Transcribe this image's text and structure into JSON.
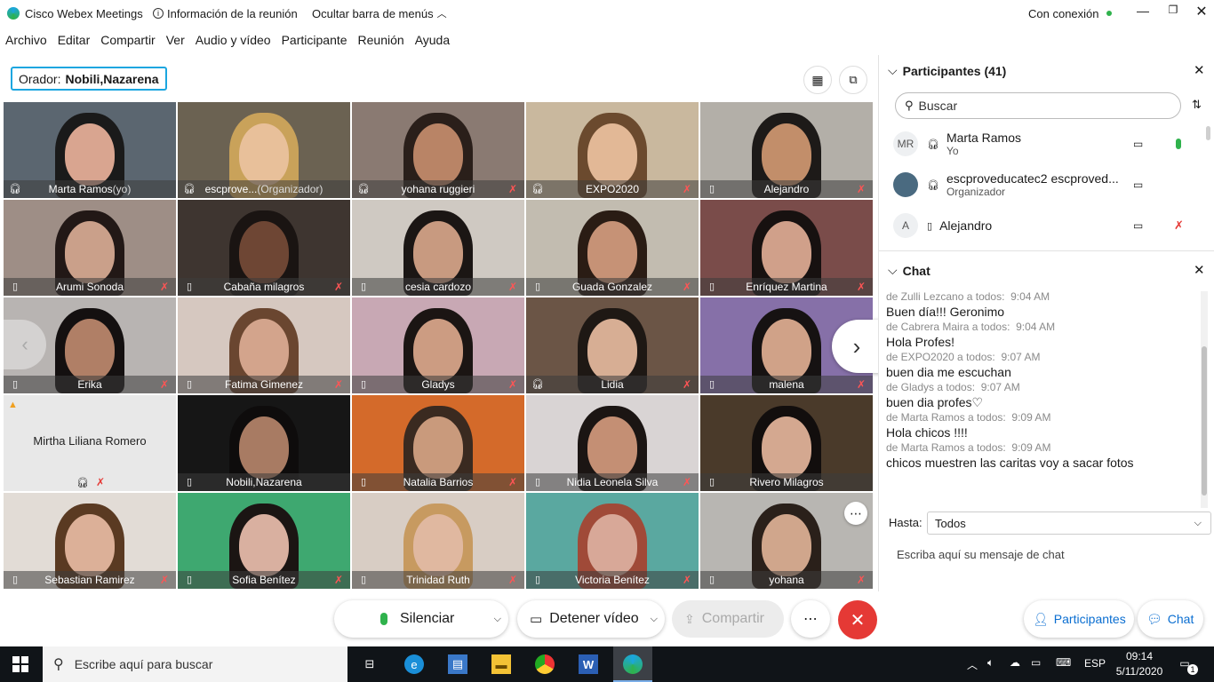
{
  "titlebar": {
    "app_name": "Cisco Webex Meetings",
    "meeting_info": "Información de la reunión",
    "hide_menu": "Ocultar barra de menús",
    "connection": "Con conexión"
  },
  "menu": [
    "Archivo",
    "Editar",
    "Compartir",
    "Ver",
    "Audio y vídeo",
    "Participante",
    "Reunión",
    "Ayuda"
  ],
  "speaker": {
    "label": "Orador:",
    "name": "Nobili,Nazarena"
  },
  "tiles": [
    {
      "name": "Marta Ramos",
      "suffix": " (yo)",
      "left": "headset",
      "right": "",
      "bg": "#5b6670",
      "skin": "#d9a590",
      "hair": "#1a1a1a"
    },
    {
      "name": "escprove...",
      "suffix": " (Organizador)",
      "left": "headset",
      "right": "",
      "bg": "#6b6252",
      "skin": "#e8c09a",
      "hair": "#c9a25a"
    },
    {
      "name": "yohana ruggieri",
      "suffix": "",
      "left": "headset",
      "right": "mic-off",
      "bg": "#8a7a72",
      "skin": "#b98466",
      "hair": "#2a1f1a"
    },
    {
      "name": "EXPO2020",
      "suffix": "",
      "left": "headset",
      "right": "mic-off",
      "bg": "#c9b89e",
      "skin": "#e2b896",
      "hair": "#6b4a2e"
    },
    {
      "name": "Alejandro",
      "suffix": "",
      "left": "phone",
      "right": "mic-off",
      "bg": "#b3afa8",
      "skin": "#c28e6a",
      "hair": "#1d1a18"
    },
    {
      "name": "Arumi Sonoda",
      "suffix": "",
      "left": "phone",
      "right": "mic-off",
      "bg": "#9e8e86",
      "skin": "#caa08a",
      "hair": "#221816"
    },
    {
      "name": "Cabaña milagros",
      "suffix": "",
      "left": "phone",
      "right": "mic-off",
      "bg": "#3e3530",
      "skin": "#6e4634",
      "hair": "#1a1412"
    },
    {
      "name": "cesia cardozo",
      "suffix": "",
      "left": "phone",
      "right": "mic-off",
      "bg": "#cfc9c2",
      "skin": "#c89a80",
      "hair": "#1b1614"
    },
    {
      "name": "Guada Gonzalez",
      "suffix": "",
      "left": "phone",
      "right": "mic-off",
      "bg": "#c2bcb0",
      "skin": "#c69276",
      "hair": "#2a1c14"
    },
    {
      "name": "Enríquez Martina",
      "suffix": "",
      "left": "phone",
      "right": "mic-off",
      "bg": "#7a4c4a",
      "skin": "#d0a08a",
      "hair": "#171110"
    },
    {
      "name": "Erika",
      "suffix": "",
      "left": "phone",
      "right": "mic-off",
      "bg": "#b8b4b2",
      "skin": "#b07f66",
      "hair": "#141010"
    },
    {
      "name": "Fatima Gimenez",
      "suffix": "",
      "left": "phone",
      "right": "mic-off",
      "bg": "#d6c8c0",
      "skin": "#d3a48c",
      "hair": "#6a4630"
    },
    {
      "name": "Gladys",
      "suffix": "",
      "left": "phone",
      "right": "mic-off",
      "bg": "#c8a8b4",
      "skin": "#cc9c82",
      "hair": "#1b1513"
    },
    {
      "name": "Lidia",
      "suffix": "",
      "left": "headset",
      "right": "mic-off",
      "bg": "#6b5546",
      "skin": "#d7ae94",
      "hair": "#1e1814"
    },
    {
      "name": "malena",
      "suffix": "",
      "left": "phone",
      "right": "mic-off",
      "bg": "#8670a8",
      "skin": "#d0a288",
      "hair": "#161212"
    },
    {
      "name": "",
      "suffix": "",
      "left": "",
      "right": "",
      "bg": "#e8e8e8",
      "skin": "",
      "hair": ""
    },
    {
      "name": "Nobili,Nazarena",
      "suffix": "",
      "left": "phone",
      "right": "",
      "bg": "#161616",
      "skin": "#a87b63",
      "hair": "#0e0c0c"
    },
    {
      "name": "Natalia Barrios",
      "suffix": "",
      "left": "phone",
      "right": "mic-off",
      "bg": "#d46a2a",
      "skin": "#c99a7c",
      "hair": "#3a2a20"
    },
    {
      "name": "Nidia Leonela Silva",
      "suffix": "",
      "left": "phone",
      "right": "mic-off",
      "bg": "#d9d4d4",
      "skin": "#c48f74",
      "hair": "#1b1513"
    },
    {
      "name": "Rivero Milagros",
      "suffix": "",
      "left": "phone",
      "right": "",
      "bg": "#4a3a2a",
      "skin": "#d4a890",
      "hair": "#120e0d"
    },
    {
      "name": "Sebastian Ramirez",
      "suffix": "",
      "left": "phone",
      "right": "mic-off",
      "bg": "#e2dcd6",
      "skin": "#dcb098",
      "hair": "#5a3a22"
    },
    {
      "name": "Sofia Benítez",
      "suffix": "",
      "left": "phone",
      "right": "mic-off",
      "bg": "#3ea870",
      "skin": "#d9b0a0",
      "hair": "#1b1513"
    },
    {
      "name": "Trinidad Ruth",
      "suffix": "",
      "left": "phone",
      "right": "mic-off",
      "bg": "#d8cdc4",
      "skin": "#e0b8a0",
      "hair": "#c79a60"
    },
    {
      "name": "Victoria Benítez",
      "suffix": "",
      "left": "phone",
      "right": "mic-off",
      "bg": "#5aa8a0",
      "skin": "#d8a898",
      "hair": "#a04a38"
    },
    {
      "name": "yohana",
      "suffix": "",
      "left": "phone",
      "right": "mic-off",
      "bg": "#b8b6b2",
      "skin": "#d0a68c",
      "hair": "#2a201a"
    }
  ],
  "placeholder_tile": {
    "name": "Mirtha Liliana Romero"
  },
  "participants_panel": {
    "title": "Participantes (41)",
    "search_placeholder": "Buscar",
    "rows": [
      {
        "initials": "MR",
        "name": "Marta Ramos",
        "sub": "Yo"
      },
      {
        "initials": "",
        "name": "escproveducatec2 escproved...",
        "sub": "Organizador"
      },
      {
        "initials": "A",
        "name": "Alejandro",
        "sub": ""
      }
    ]
  },
  "chat_panel": {
    "title": "Chat",
    "messages": [
      {
        "meta": "de Zulli Lezcano a todos:",
        "time": "9:04 AM",
        "text": "Buen día!!! Geronimo"
      },
      {
        "meta": "de Cabrera Maira a todos:",
        "time": "9:04 AM",
        "text": "Hola Profes!"
      },
      {
        "meta": "de EXPO2020 a todos:",
        "time": "9:07 AM",
        "text": "buen dia me escuchan"
      },
      {
        "meta": "de Gladys a todos:",
        "time": "9:07 AM",
        "text": "buen dia profes♡"
      },
      {
        "meta": "de Marta Ramos a todos:",
        "time": "9:09 AM",
        "text": "Hola chicos !!!!"
      },
      {
        "meta": "de Marta Ramos a todos:",
        "time": "9:09 AM",
        "text": "chicos muestren las caritas voy a sacar fotos"
      }
    ],
    "to_label": "Hasta:",
    "to_value": "Todos",
    "input_placeholder": "Escriba aquí su mensaje de chat"
  },
  "controls": {
    "mute": "Silenciar",
    "video": "Detener vídeo",
    "share": "Compartir",
    "participants": "Participantes",
    "chat": "Chat"
  },
  "taskbar": {
    "search_placeholder": "Escribe aquí para buscar",
    "lang": "ESP",
    "time": "09:14",
    "date": "5/11/2020",
    "notif": "1"
  },
  "colors": {
    "accent": "#1ba6e0",
    "red": "#e53935",
    "green": "#2fb24c",
    "blue_link": "#0a6ed1"
  }
}
